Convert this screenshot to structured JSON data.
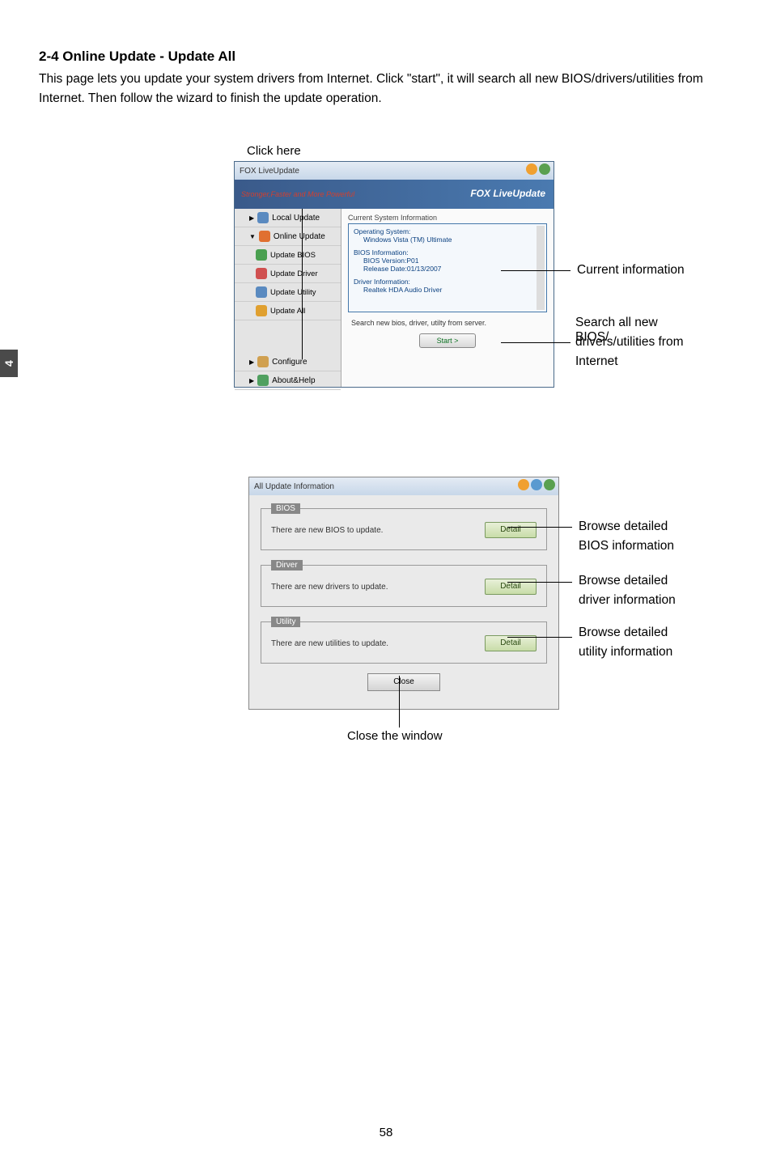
{
  "page_tab": "4",
  "section_title": "2-4 Online Update - Update All",
  "intro_text": "This page lets you update your system drivers from Internet. Click \"start\", it will search all new BIOS/drivers/utilities from Internet. Then follow the wizard to finish the update operation.",
  "click_here": "Click here",
  "app1": {
    "title": "FOX LiveUpdate",
    "banner_tagline": "Stronger,Faster and More Powerful",
    "banner_logo": "FOX LiveUpdate",
    "sidebar": {
      "local": "Local Update",
      "online": "Online Update",
      "update_bios": "Update BIOS",
      "update_driver": "Update Driver",
      "update_utility": "Update Utility",
      "update_all": "Update All",
      "configure": "Configure",
      "about": "About&Help"
    },
    "panel": {
      "current_label": "Current System Information",
      "os_title": "Operating System:",
      "os_value": "Windows Vista (TM) Ultimate",
      "bios_title": "BIOS Information:",
      "bios_version": "BIOS Version:P01",
      "bios_date": "Release Date:01/13/2007",
      "driver_title": "Driver Information:",
      "driver_value": "Realtek HDA Audio Driver",
      "search_label": "Search new bios, driver, utilty from server.",
      "start_btn": "Start  >"
    }
  },
  "annot1": {
    "current_info": "Current information",
    "search_line1": "Search all new BIOS/",
    "search_line2": "drivers/utilities from",
    "search_line3": "Internet"
  },
  "app2": {
    "title": "All Update Information",
    "bios_legend": "BIOS",
    "bios_msg": "There are new BIOS to update.",
    "driver_legend": "Dirver",
    "driver_msg": "There are new drivers to update.",
    "utility_legend": "Utility",
    "utility_msg": "There are new utilities to update.",
    "detail_btn": "Detail",
    "close_btn": "Close"
  },
  "annot2": {
    "bios_line1": "Browse detailed",
    "bios_line2": "BIOS information",
    "driver_line1": "Browse detailed",
    "driver_line2": "driver information",
    "utility_line1": "Browse detailed",
    "utility_line2": "utility information",
    "close_caption": "Close the window"
  },
  "page_number": "58"
}
